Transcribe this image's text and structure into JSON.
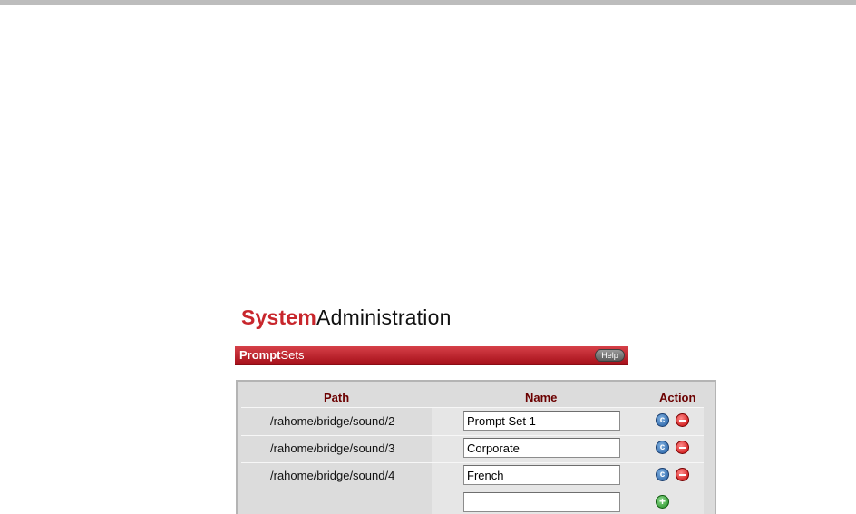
{
  "title": {
    "part1": "System",
    "part2": "Administration"
  },
  "section": {
    "part1": "Prompt",
    "part2": "Sets",
    "help_label": "Help"
  },
  "table": {
    "headers": {
      "path": "Path",
      "name": "Name",
      "action": "Action"
    },
    "rows": [
      {
        "path": "/rahome/bridge/sound/2",
        "name": "Prompt Set 1"
      },
      {
        "path": "/rahome/bridge/sound/3",
        "name": "Corporate"
      },
      {
        "path": "/rahome/bridge/sound/4",
        "name": "French"
      }
    ],
    "new_row": {
      "name": ""
    }
  },
  "icons": {
    "copy": "copy-icon",
    "delete": "minus-icon",
    "add": "plus-icon"
  },
  "colors": {
    "brand_red": "#c8262c",
    "header_text": "#6b0000",
    "panel_bg": "#dcdcdc"
  }
}
